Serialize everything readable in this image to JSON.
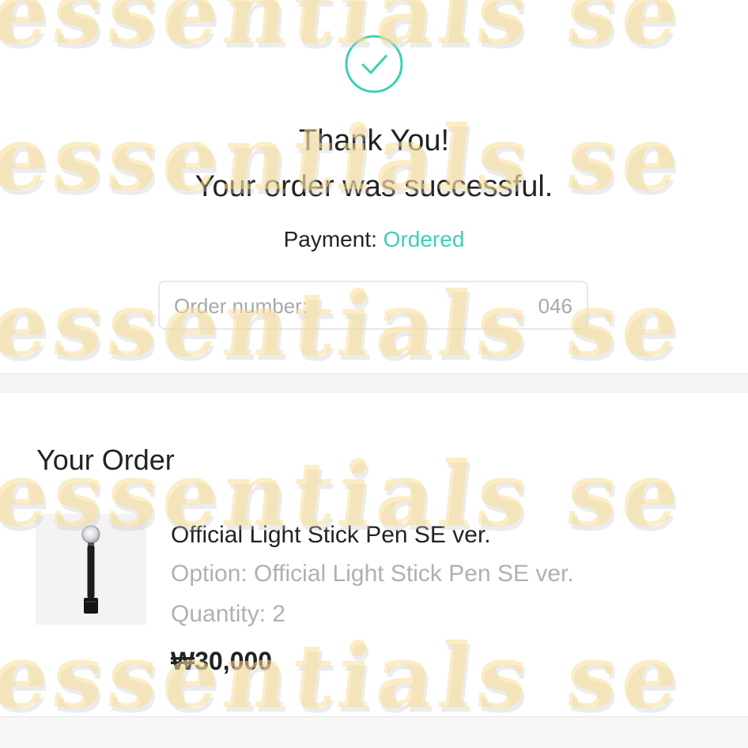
{
  "confirmation": {
    "check_icon": "check-circle-icon",
    "title": "Thank You!",
    "subtitle": "Your order was successful.",
    "payment_label": "Payment:",
    "payment_status": "Ordered",
    "order_number_label": "Order number: ",
    "order_number_value": "046"
  },
  "order": {
    "section_title": "Your Order",
    "item": {
      "thumbnail_icon": "light-stick-image",
      "name": "Official Light Stick Pen SE ver.",
      "option": "Option: Official Light Stick Pen SE ver.",
      "quantity": "Quantity: 2",
      "price": "₩30,000"
    }
  },
  "watermark": {
    "text": "essentials  se"
  },
  "colors": {
    "accent": "#3ccfb4",
    "muted_text": "#b0b0b0",
    "divider": "#f4f5f7"
  }
}
